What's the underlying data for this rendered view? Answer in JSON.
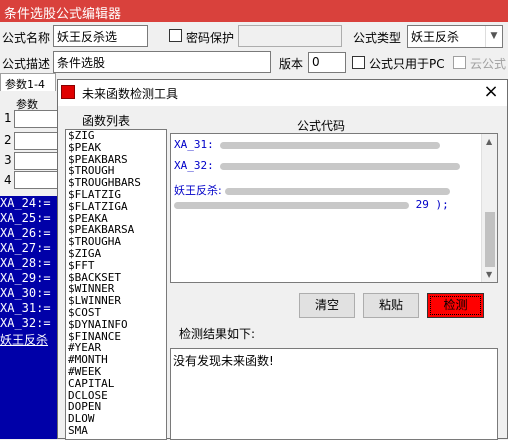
{
  "window": {
    "title": "条件选股公式编辑器"
  },
  "form": {
    "name_label": "公式名称",
    "name_value": "妖王反杀选",
    "password_label": "密码保护",
    "type_label": "公式类型",
    "type_value": "妖王反杀",
    "desc_label": "公式描述",
    "desc_value": "条件选股",
    "version_label": "版本",
    "version_value": "0",
    "pc_only_label": "公式只用于PC",
    "cloud_label": "云公式"
  },
  "params": {
    "tab_label": "参数1-4",
    "col_header": "参数",
    "rows": [
      "1",
      "2",
      "3",
      "4"
    ]
  },
  "editor": {
    "lines": [
      "XA_24:=",
      "XA_25:=",
      "XA_26:=",
      "XA_27:=",
      "XA_28:=",
      "XA_29:=",
      "XA_30:=",
      "XA_31:=",
      "XA_32:=",
      "妖王反杀"
    ]
  },
  "dialog": {
    "title": "未来函数检测工具",
    "func_list_header": "函数列表",
    "func_list": [
      "$ZIG",
      "$PEAK",
      "$PEAKBARS",
      "$TROUGH",
      "$TROUGHBARS",
      "$FLATZIG",
      "$FLATZIGA",
      "$PEAKA",
      "$PEAKBARSA",
      "$TROUGHA",
      "$ZIGA",
      "$FFT",
      "$BACKSET",
      "$WINNER",
      "$LWINNER",
      "$COST",
      "$DYNAINFO",
      "$FINANCE",
      "#YEAR",
      "#MONTH",
      "#WEEK",
      "CAPITAL",
      "DCLOSE",
      "DOPEN",
      "DLOW",
      "SMA"
    ],
    "code_header": "公式代码",
    "code_line1_prefix": "XA_31:",
    "code_line2_prefix": "XA_32:",
    "code_line3_prefix": "妖王反杀:",
    "code_line4_suffix": "29 );",
    "btn_clear": "清空",
    "btn_paste": "粘贴",
    "btn_detect": "检测",
    "result_label": "检测结果如下:",
    "result_text": "没有发现未来函数!",
    "close_icon": "×",
    "accent_red": "#e00000"
  }
}
